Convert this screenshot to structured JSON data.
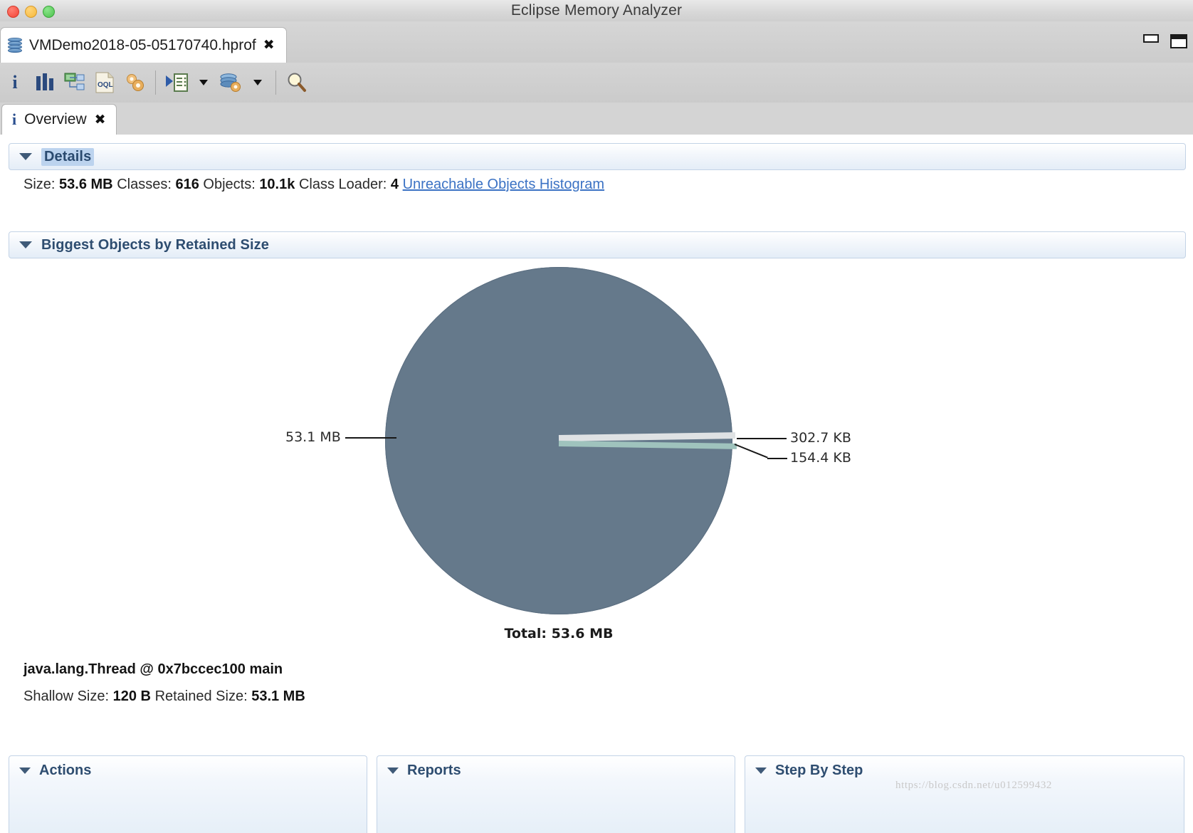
{
  "window": {
    "title": "Eclipse Memory Analyzer",
    "traffic_lights": [
      "close",
      "minimize",
      "zoom"
    ],
    "minimize_label": "",
    "maximize_label": ""
  },
  "file_tab": {
    "label": "VMDemo2018-05-05170740.hprof",
    "close_glyph": "✕",
    "icon": "heap-dump-icon"
  },
  "toolbar": {
    "buttons": [
      {
        "name": "overview-info-icon",
        "glyph": "i"
      },
      {
        "name": "histogram-icon",
        "glyph": "▌▌▌"
      },
      {
        "name": "dominator-tree-icon",
        "glyph": ""
      },
      {
        "name": "oql-icon",
        "glyph": "OQL"
      },
      {
        "name": "calculate-retained-size-icon",
        "glyph": ""
      },
      {
        "name": "run-expert-system-test-icon",
        "glyph": ""
      },
      {
        "name": "open-query-browser-icon",
        "glyph": ""
      },
      {
        "name": "find-object-icon",
        "glyph": ""
      }
    ]
  },
  "view_tab": {
    "label": "Overview",
    "close_glyph": "✕",
    "icon": "info-icon"
  },
  "details": {
    "title": "Details",
    "size_label": "Size:",
    "size_value": "53.6 MB",
    "classes_label": "Classes:",
    "classes_value": "616",
    "objects_label": "Objects:",
    "objects_value": "10.1k",
    "class_loader_label": "Class Loader:",
    "class_loader_value": "4",
    "link": "Unreachable Objects Histogram"
  },
  "biggest_objects": {
    "title": "Biggest Objects by Retained Size",
    "selected_object_title": "java.lang.Thread @ 0x7bccec100 main",
    "shallow_size_label": "Shallow Size:",
    "shallow_size_value": "120 B",
    "retained_size_label": "Retained Size:",
    "retained_size_value": "53.1 MB"
  },
  "chart_data": {
    "type": "pie",
    "title": "Biggest Objects by Retained Size",
    "total_label": "Total: 53.6 MB",
    "total_value_mb": 53.6,
    "unit": "bytes",
    "legend": "none",
    "labels": [
      "53.1 MB",
      "302.7 KB",
      "154.4 KB"
    ],
    "values": [
      55700000,
      309965,
      158106
    ],
    "display_values": [
      "53.1 MB",
      "302.7 KB",
      "154.4 KB"
    ],
    "percentages": [
      99.1,
      0.55,
      0.28
    ],
    "colors": [
      "#65798b",
      "#dfe2e4",
      "#9fc3bd"
    ],
    "label_positions": [
      "left",
      "right",
      "right"
    ]
  },
  "panels": [
    {
      "title": "Actions"
    },
    {
      "title": "Reports"
    },
    {
      "title": "Step By Step"
    }
  ],
  "watermark": "https://blog.csdn.net/u012599432",
  "colors": {
    "pie_main": "#65798b",
    "pie_second": "#dfe2e4",
    "pie_third": "#9fc3bd",
    "link": "#3b72c4",
    "section_title": "#2e4d70",
    "selection": "#bcd3ee"
  }
}
